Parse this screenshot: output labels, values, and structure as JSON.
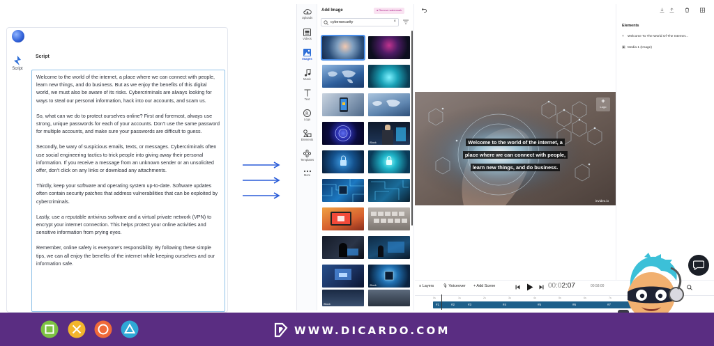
{
  "script_panel": {
    "rail_label": "Script",
    "title": "Script",
    "paragraphs": [
      "Welcome to the world of the internet, a place where we can connect with people, learn new things, and do business. But as we enjoy the benefits of this digital world, we must also be aware of its risks. Cybercriminals are always looking for ways to steal our personal information, hack into our accounts, and scam us.",
      "So, what can we do to protect ourselves online? First and foremost, always use strong, unique passwords for each of your accounts. Don't use the same password for multiple accounts, and make sure your passwords are difficult to guess.",
      "Secondly, be wary of suspicious emails, texts, or messages. Cybercriminals often use social engineering tactics to trick people into giving away their personal information. If you receive a message from an unknown sender or an unsolicited offer, don't click on any links or download any attachments.",
      "Thirdly, keep your software and operating system up-to-date. Software updates often contain security patches that address vulnerabilities that can be exploited by cybercriminals.",
      "Lastly, use a reputable antivirus software and a virtual private network (VPN) to encrypt your internet connection. This helps protect your online activities and sensitive information from prying eyes.",
      "Remember, online safety is everyone's responsibility. By following these simple tips, we can all enjoy the benefits of the internet while keeping ourselves and our information safe."
    ]
  },
  "editor": {
    "tools": [
      {
        "label": "Uploads",
        "icon": "upload-cloud-icon"
      },
      {
        "label": "Videos",
        "icon": "video-icon"
      },
      {
        "label": "Images",
        "icon": "image-icon",
        "active": true
      },
      {
        "label": "Music",
        "icon": "music-icon"
      },
      {
        "label": "Text",
        "icon": "text-icon"
      },
      {
        "label": "Logo",
        "icon": "logo-icon"
      },
      {
        "label": "Elements",
        "icon": "elements-icon"
      },
      {
        "label": "Templates",
        "icon": "templates-icon"
      },
      {
        "label": "More",
        "icon": "more-icon"
      }
    ],
    "gallery": {
      "title": "Add Image",
      "remove_watermark": "Remove watermark",
      "search_value": "cybersecurity",
      "thumb_tags": [
        "iStock",
        "iStock",
        "iStock"
      ]
    },
    "preview": {
      "caption_lines": [
        "Welcome to the world of the internet, a",
        "place where we can connect with people,",
        "learn new things, and do business."
      ],
      "logo_button_label": "Logo",
      "watermark": "invideo.io"
    },
    "elements_panel": {
      "title": "Elements",
      "items": [
        {
          "icon": "text-icon",
          "label": "Welcome To The World Of The Internet..."
        },
        {
          "icon": "image-icon",
          "label": "Media 1 (Image)"
        }
      ]
    },
    "timeline": {
      "layers_label": "Layers",
      "voiceover_label": "Voiceover",
      "add_scene_label": "+ Add Scene",
      "current_time_dim": "00:0",
      "current_time": "2:07",
      "total_time": "00:58:00",
      "ruler_labels": [
        "0s",
        "1s",
        "2s",
        "3s",
        "4s",
        "5s",
        "6s",
        "7s",
        "8s"
      ],
      "scenes": [
        "#1",
        "#2",
        "#3",
        "#4",
        "#5",
        "#6",
        "#7"
      ]
    }
  },
  "banner": {
    "brand_text": "WWW.DICARDO.COM",
    "colors": {
      "background": "#5a2d82",
      "square": "#7cc242",
      "cross": "#f3b52c",
      "circle": "#ef6a3a",
      "triangle": "#2fa8d6"
    }
  }
}
